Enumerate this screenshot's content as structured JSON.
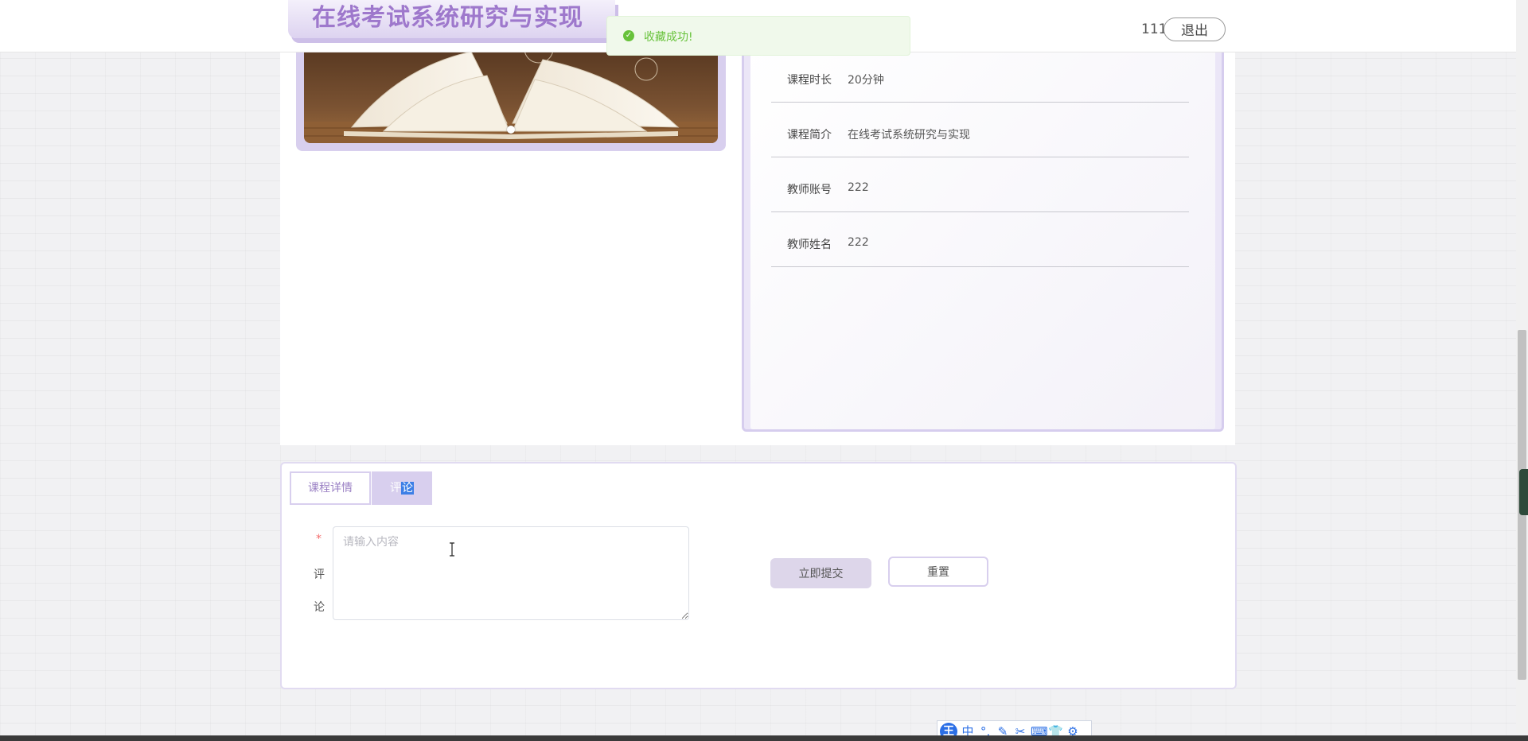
{
  "header": {
    "site_title": "在线考试系统研究与实现",
    "toast_message": "收藏成功!",
    "username": "111",
    "logout_label": "退出"
  },
  "course_info": [
    {
      "label": "课程时长",
      "value": "20分钟"
    },
    {
      "label": "课程简介",
      "value": "在线考试系统研究与实现"
    },
    {
      "label": "教师账号",
      "value": "222"
    },
    {
      "label": "教师姓名",
      "value": "222"
    }
  ],
  "tabs": {
    "detail_label": "课程详情",
    "comment_label_a": "评",
    "comment_label_b": "论"
  },
  "comment_form": {
    "required_mark": "*",
    "label_char_1": "评",
    "label_char_2": "论",
    "placeholder": "请输入内容",
    "value": "",
    "submit_label": "立即提交",
    "reset_label": "重置"
  },
  "ime": {
    "logo": "王",
    "items": [
      "中",
      "°,",
      "✎",
      "✂",
      "⌨",
      "👕",
      "⚙"
    ]
  },
  "colors": {
    "accent": "#9e78cc",
    "accent_light": "#d8cfee",
    "success": "#67c23a",
    "required": "#f56c6c"
  }
}
